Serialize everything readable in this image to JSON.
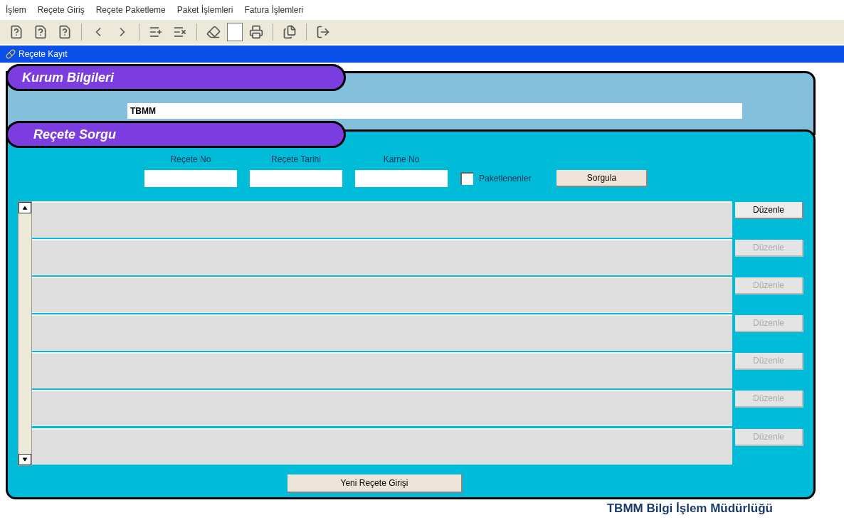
{
  "menu": [
    "İşlem",
    "Reçete Giriş",
    "Reçete Paketleme",
    "Paket İşlemleri",
    "Fatura İşlemleri"
  ],
  "window": {
    "title": "Reçete Kayıt"
  },
  "kurum": {
    "heading": "Kurum Bilgileri",
    "value": "TBMM"
  },
  "sorgu": {
    "heading": "Reçete Sorgu",
    "fields": [
      {
        "label": "Reçete No"
      },
      {
        "label": "Reçete Tarihi"
      },
      {
        "label": "Karne No"
      }
    ],
    "checkbox": {
      "label": "Paketlenenler",
      "checked": false
    },
    "button": "Sorgula"
  },
  "rows": [
    {
      "action": "Düzenle",
      "disabled": false
    },
    {
      "action": "Düzenle",
      "disabled": true
    },
    {
      "action": "Düzenle",
      "disabled": true
    },
    {
      "action": "Düzenle",
      "disabled": true
    },
    {
      "action": "Düzenle",
      "disabled": true
    },
    {
      "action": "Düzenle",
      "disabled": true
    },
    {
      "action": "Düzenle",
      "disabled": true
    }
  ],
  "new_button": "Yeni Reçete Girişi",
  "footer": "TBMM Bilgi İşlem Müdürlüğü"
}
